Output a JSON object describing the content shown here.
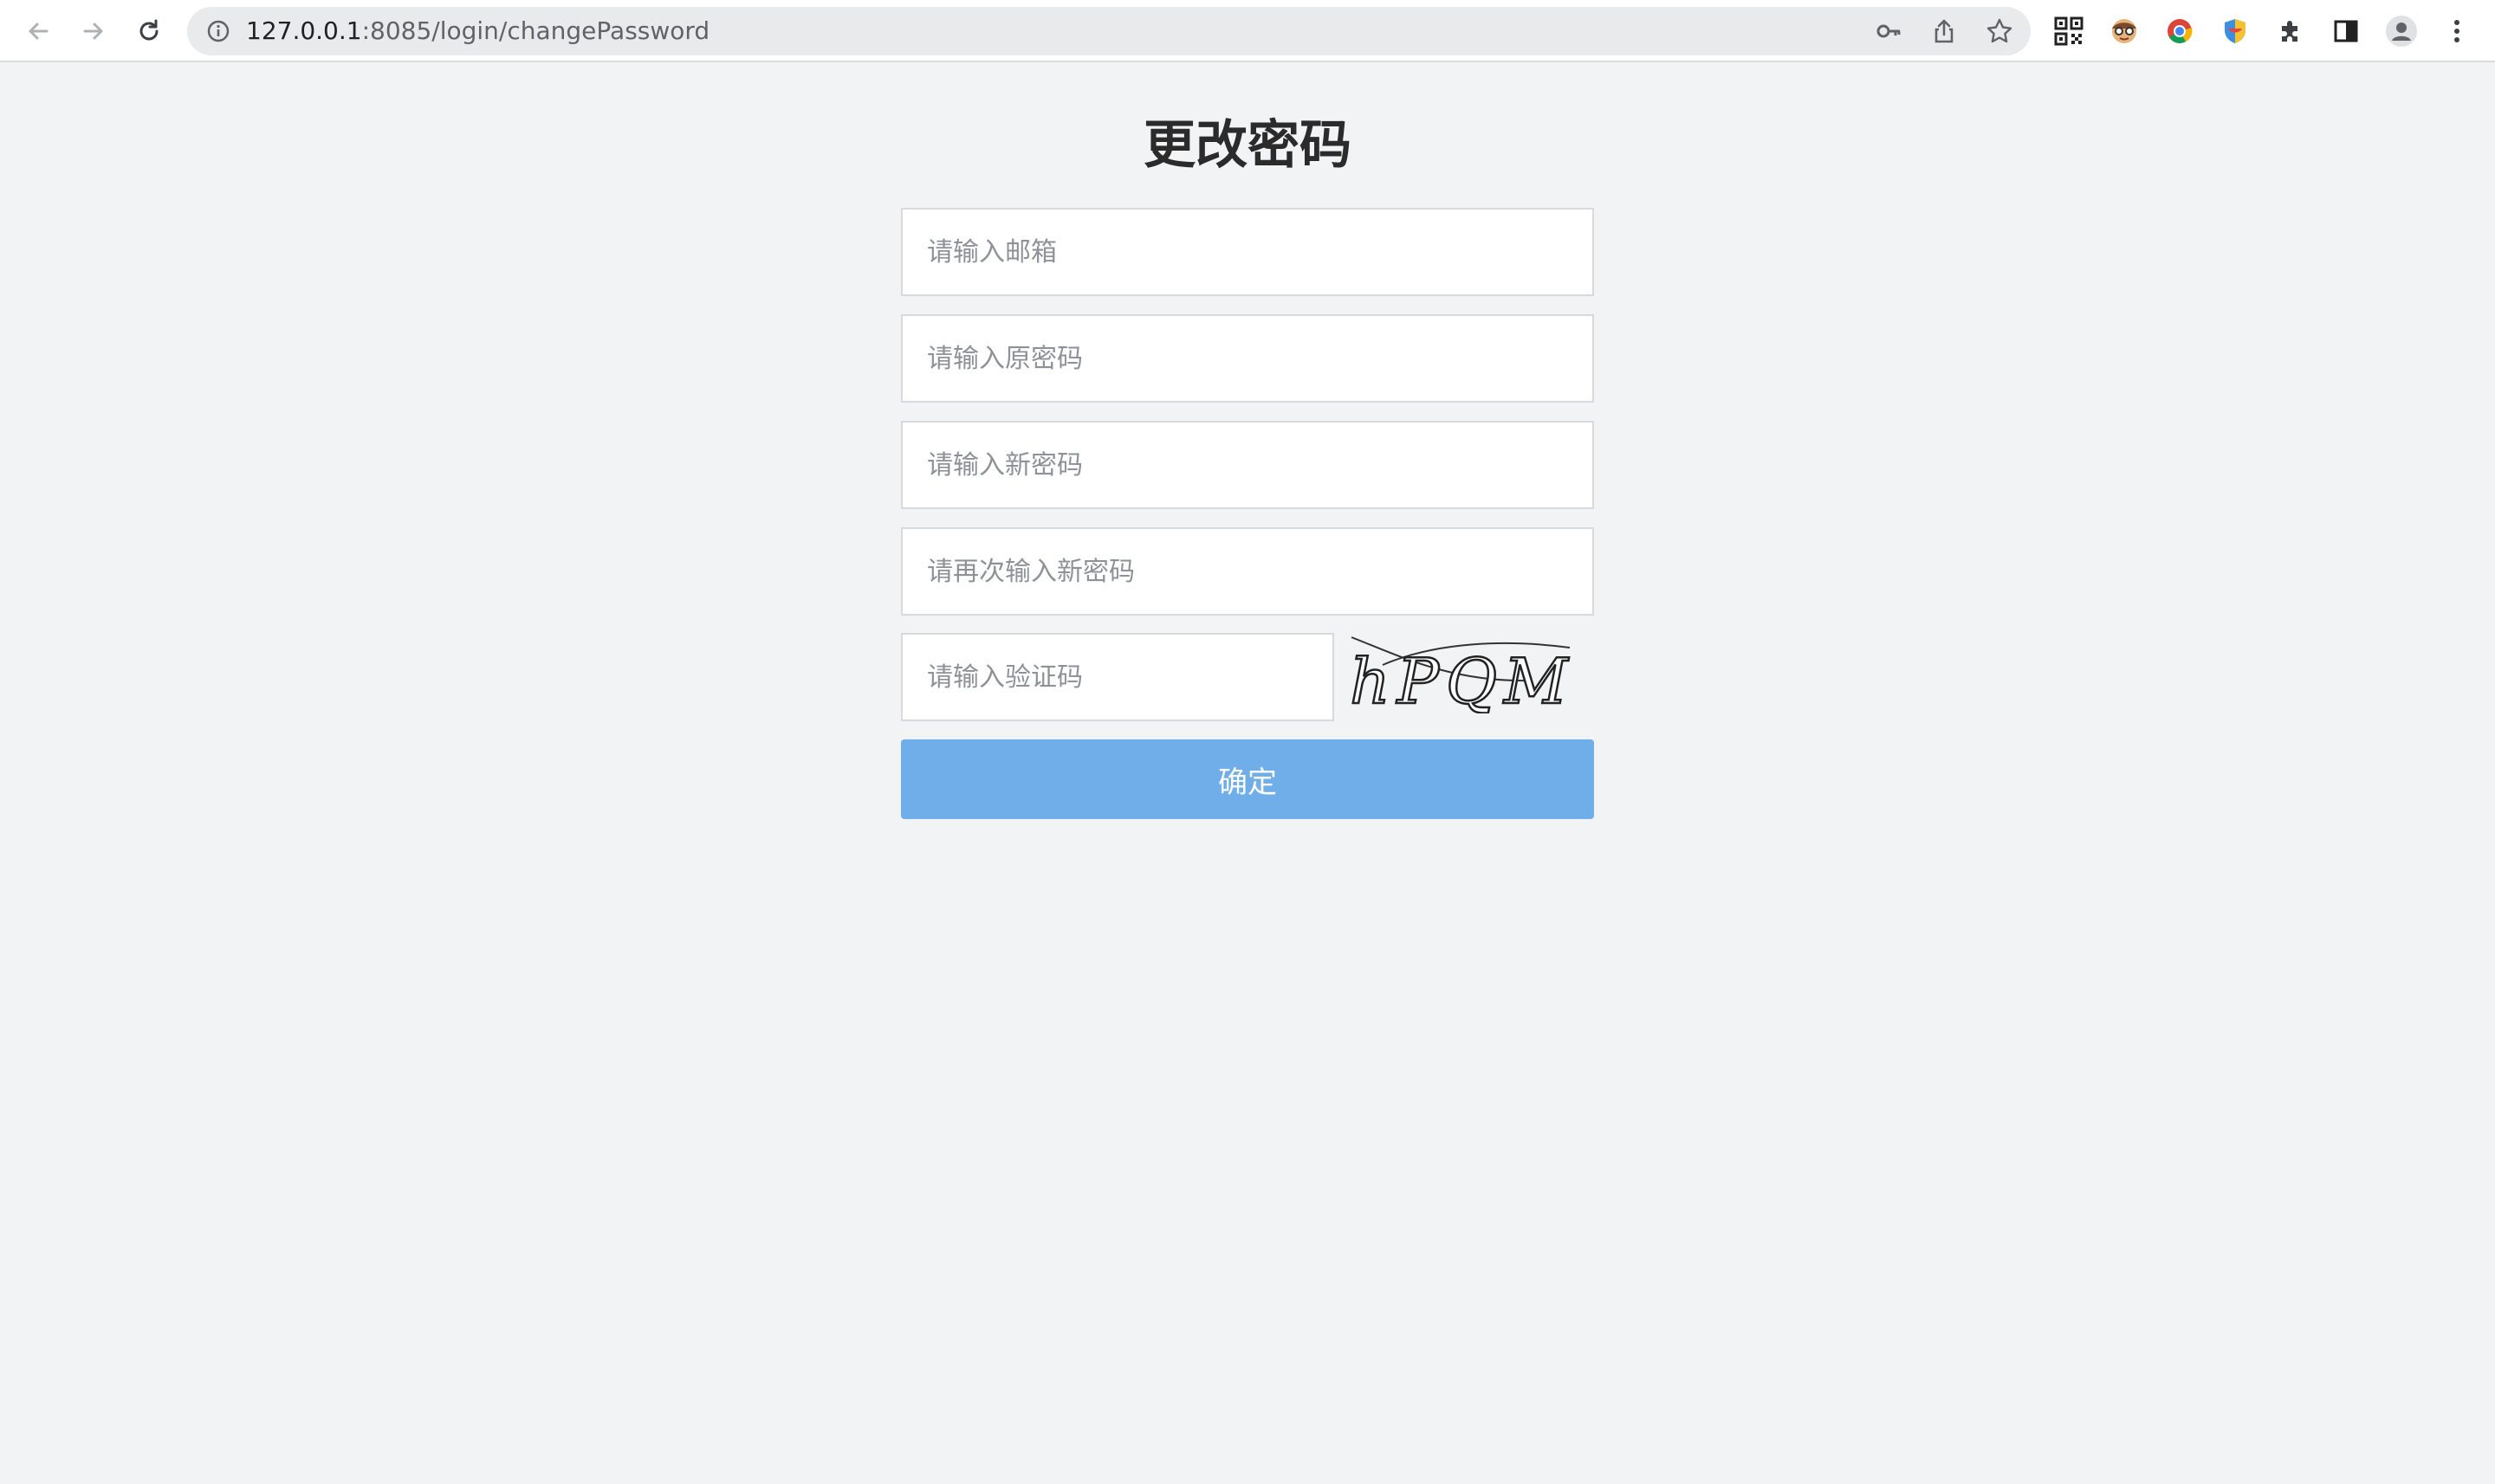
{
  "browser": {
    "url_host": "127.0.0.1",
    "url_rest": ":8085/login/changePassword",
    "icons": [
      "back-icon",
      "forward-icon",
      "reload-icon",
      "site-info-icon",
      "password-key-icon",
      "share-icon",
      "bookmark-star-icon",
      "qr-code-icon",
      "extension-face-icon",
      "extension-chrome-icon",
      "extension-shield-icon",
      "extensions-puzzle-icon",
      "side-panel-icon",
      "profile-avatar-icon",
      "menu-kebab-icon"
    ]
  },
  "form": {
    "title": "更改密码",
    "email_placeholder": "请输入邮箱",
    "old_password_placeholder": "请输入原密码",
    "new_password_placeholder": "请输入新密码",
    "confirm_password_placeholder": "请再次输入新密码",
    "captcha_placeholder": "请输入验证码",
    "captcha_text": "hPQM",
    "submit_label": "确定"
  },
  "colors": {
    "page_bg": "#f2f3f5",
    "button_bg": "#70aeea",
    "button_text": "#ffffff"
  }
}
